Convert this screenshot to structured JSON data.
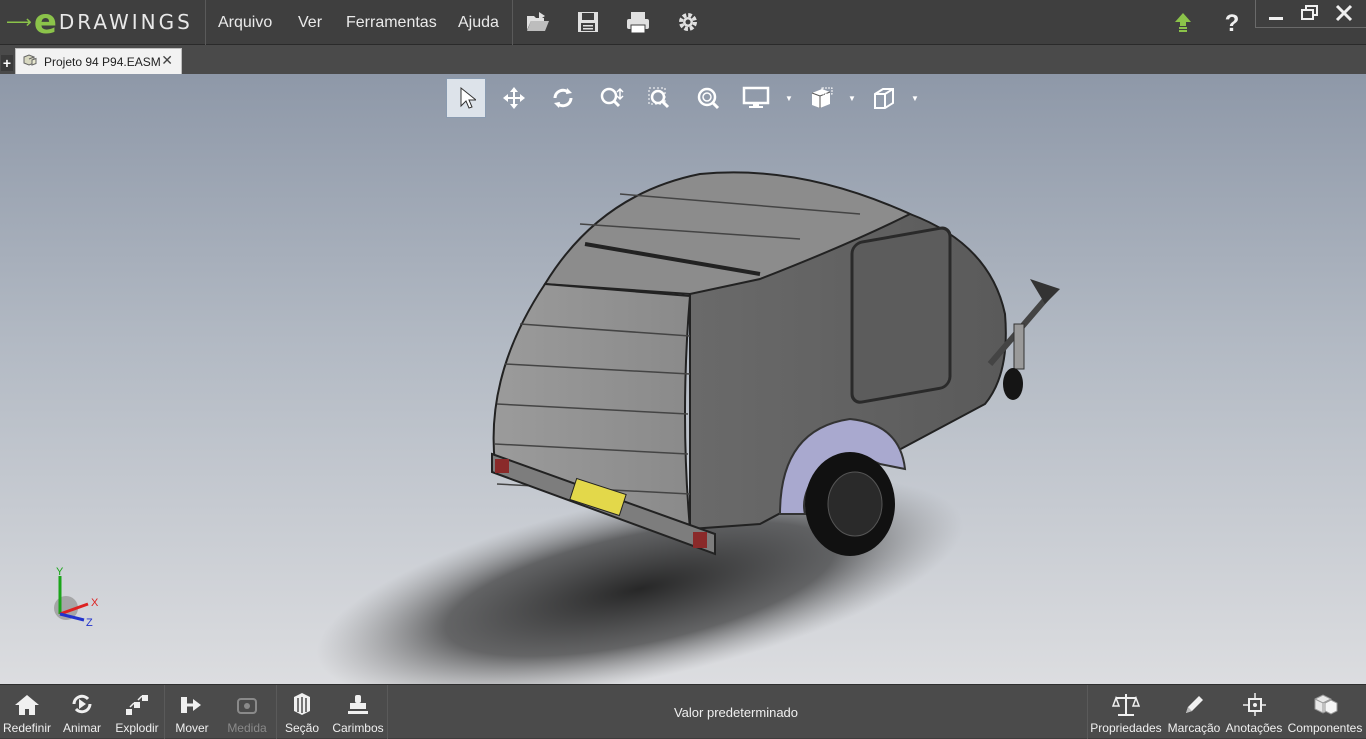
{
  "app": {
    "brand": "DRAWINGS",
    "brand_mark": "e",
    "accent_color": "#8bc34a"
  },
  "menu": {
    "items": [
      {
        "label": "Arquivo"
      },
      {
        "label": "Ver"
      },
      {
        "label": "Ferramentas"
      },
      {
        "label": "Ajuda"
      }
    ]
  },
  "toolbar_icons": [
    "open-icon",
    "save-icon",
    "print-icon",
    "settings-icon",
    "upload-icon",
    "help-icon"
  ],
  "window_controls": [
    "minimize-icon",
    "restore-icon",
    "close-icon"
  ],
  "tab": {
    "plus": "+",
    "title": "Projeto 94 P94.EASM",
    "close": "✕"
  },
  "view_toolbar": [
    {
      "name": "select-icon",
      "active": true
    },
    {
      "name": "pan-icon"
    },
    {
      "name": "rotate-icon"
    },
    {
      "name": "zoom-icon"
    },
    {
      "name": "zoom-to-area-icon"
    },
    {
      "name": "zoom-to-fit-icon"
    },
    {
      "name": "display-style-icon",
      "dropdown": true
    },
    {
      "name": "view-orientation-icon",
      "dropdown": true
    },
    {
      "name": "standard-views-icon",
      "dropdown": true
    }
  ],
  "triad": {
    "x": "X",
    "y": "Y",
    "z": "Z"
  },
  "bottom_toolbar": {
    "left": [
      {
        "label": "Redefinir",
        "icon": "home-icon"
      },
      {
        "label": "Animar",
        "icon": "animate-icon"
      },
      {
        "label": "Explodir",
        "icon": "explode-icon"
      },
      {
        "label": "Mover",
        "icon": "move-icon"
      },
      {
        "label": "Medida",
        "icon": "measure-icon",
        "disabled": true
      },
      {
        "label": "Seção",
        "icon": "section-icon"
      },
      {
        "label": "Carimbos",
        "icon": "stamp-icon"
      }
    ],
    "status": "Valor predeterminado",
    "right": [
      {
        "label": "Propriedades",
        "icon": "scale-icon"
      },
      {
        "label": "Marcação",
        "icon": "pencil-icon"
      },
      {
        "label": "Anotações",
        "icon": "annotation-icon"
      },
      {
        "label": "Componentes",
        "icon": "components-icon"
      }
    ]
  }
}
